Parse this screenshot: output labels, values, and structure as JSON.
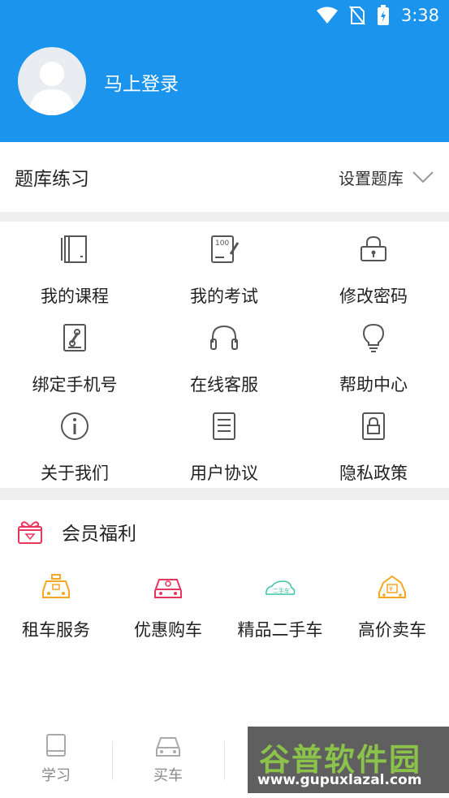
{
  "status_bar": {
    "time": "3:38"
  },
  "profile": {
    "login_label": "马上登录"
  },
  "question_bank": {
    "title": "题库练习",
    "action_label": "设置题库"
  },
  "menu": {
    "items": [
      {
        "label": "我的课程",
        "icon": "book-icon"
      },
      {
        "label": "我的考试",
        "icon": "exam-paper-icon"
      },
      {
        "label": "修改密码",
        "icon": "lock-icon"
      },
      {
        "label": "绑定手机号",
        "icon": "phone-link-icon"
      },
      {
        "label": "在线客服",
        "icon": "headset-icon"
      },
      {
        "label": "帮助中心",
        "icon": "lightbulb-icon"
      },
      {
        "label": "关于我们",
        "icon": "info-icon"
      },
      {
        "label": "用户协议",
        "icon": "document-icon"
      },
      {
        "label": "隐私政策",
        "icon": "privacy-lock-icon"
      }
    ]
  },
  "member": {
    "title": "会员福利",
    "icon": "gift-icon",
    "benefits": [
      {
        "label": "租车服务",
        "icon": "taxi-icon",
        "color": "#f5a623"
      },
      {
        "label": "优惠购车",
        "icon": "car-icon",
        "color": "#e8365d"
      },
      {
        "label": "精品二手车",
        "icon": "used-car-icon",
        "color": "#3cc3a8",
        "badge": "二手车"
      },
      {
        "label": "高价卖车",
        "icon": "sell-car-icon",
        "color": "#f5a623"
      }
    ]
  },
  "bottom_nav": {
    "items": [
      {
        "label": "学习",
        "icon": "book-nav-icon"
      },
      {
        "label": "买车",
        "icon": "car-nav-icon"
      }
    ]
  },
  "watermark": {
    "title": "谷普软件园",
    "url": "www.gupuxlazal.com"
  },
  "colors": {
    "header_bg": "#1b94ee",
    "accent": "#1b94ee"
  }
}
